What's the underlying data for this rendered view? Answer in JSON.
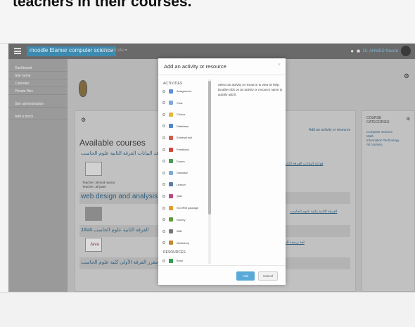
{
  "slide": {
    "caption": "teachers in their courses."
  },
  "navbar": {
    "site_name": "moodle Elamer computer science",
    "menu_label": "Recent site ▾",
    "user_name": "Dr. AHMED Nasrat"
  },
  "drawer": {
    "items": [
      "Dashboard",
      "Site home",
      "Calendar",
      "Private files",
      "Site administration",
      "Add a block"
    ]
  },
  "main": {
    "add_activity_link": "Add an activity or resource",
    "available_title": "Available courses",
    "courses": [
      {
        "title": "قواعد البيانات الفرقة الثانية علوم الحاسب",
        "rtl_link": "قواعد البيانات الفرقة الثانية بكلية",
        "teacher1": "Teacher: ahmed nasrat",
        "teacher2": "Teacher: ali jaser"
      },
      {
        "title": "web design and analysis مقرر",
        "rtl_link": "الفرقة الثانية بكلية علوم الحاسب"
      },
      {
        "title": "JAVA الفرقة الثانية علوم الحاسب",
        "rtl_link": "لغة برمجة للمرحلة الثانوية",
        "thumb_label": "Java"
      },
      {
        "title": "مقرر الفرقة الأولى كلية علوم الحاسب"
      }
    ]
  },
  "categories": {
    "title_line1": "COURSE",
    "title_line2": "CATEGORIES",
    "items": [
      "Computer Science",
      "Math",
      "Information Technology",
      "All courses..."
    ]
  },
  "modal": {
    "title": "Add an activity or resource",
    "activities_header": "ACTIVITIES",
    "resources_header": "RESOURCES",
    "activities": [
      "Assignment",
      "Chat",
      "Choice",
      "Database",
      "External tool",
      "Feedback",
      "Forum",
      "Glossary",
      "Lesson",
      "Quiz",
      "SCORM package",
      "Survey",
      "Wiki",
      "Workshop"
    ],
    "resources": [
      "Book"
    ],
    "description": "Select an activity or resource to view its help. Double-click on an activity or resource name to quickly add it.",
    "add_label": "Add",
    "cancel_label": "Cancel"
  }
}
